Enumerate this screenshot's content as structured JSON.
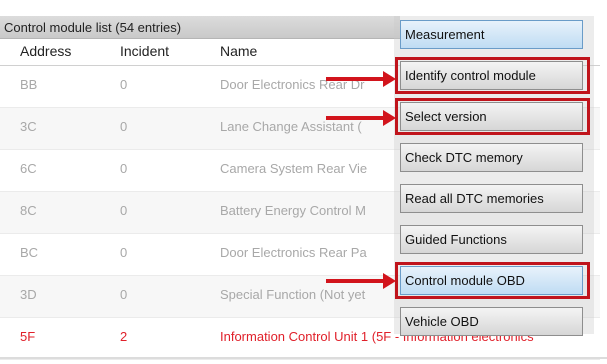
{
  "list": {
    "title": "Control module list (54 entries)",
    "headers": {
      "address": "Address",
      "incident": "Incident",
      "name": "Name"
    },
    "rows": [
      {
        "address": "BB",
        "incident": "0",
        "name": "Door Electronics Rear Dr"
      },
      {
        "address": "3C",
        "incident": "0",
        "name": "Lane Change Assistant ("
      },
      {
        "address": "6C",
        "incident": "0",
        "name": "Camera System Rear Vie"
      },
      {
        "address": "8C",
        "incident": "0",
        "name": "Battery Energy Control M"
      },
      {
        "address": "BC",
        "incident": "0",
        "name": "Door Electronics Rear Pa"
      },
      {
        "address": "3D",
        "incident": "0",
        "name": "Special Function (Not yet"
      },
      {
        "address": "5F",
        "incident": "2",
        "name": "Information Control Unit 1 (5F - Information electronics"
      }
    ],
    "error_color": "#e0202a"
  },
  "menu": {
    "items": [
      {
        "label": "Measurement"
      },
      {
        "label": "Identify control module"
      },
      {
        "label": "Select version"
      },
      {
        "label": "Check DTC memory"
      },
      {
        "label": "Read all DTC memories"
      },
      {
        "label": "Guided Functions"
      },
      {
        "label": "Control module OBD"
      },
      {
        "label": "Vehicle OBD"
      }
    ],
    "highlighted": [
      "Identify control module",
      "Select version",
      "Control module OBD"
    ],
    "highlight_color": "#c0141c"
  }
}
